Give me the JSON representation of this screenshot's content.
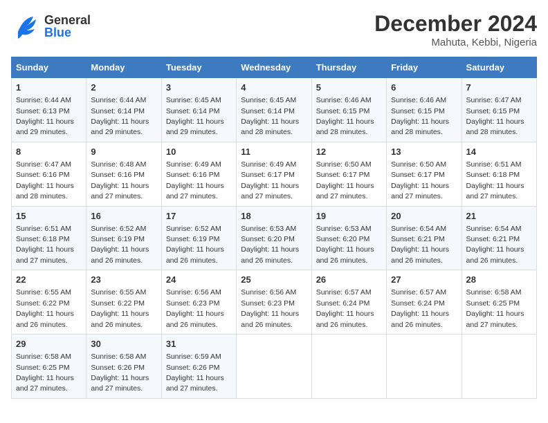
{
  "header": {
    "logo_general": "General",
    "logo_blue": "Blue",
    "month_title": "December 2024",
    "location": "Mahuta, Kebbi, Nigeria"
  },
  "days_of_week": [
    "Sunday",
    "Monday",
    "Tuesday",
    "Wednesday",
    "Thursday",
    "Friday",
    "Saturday"
  ],
  "weeks": [
    [
      {
        "day": "1",
        "sunrise": "Sunrise: 6:44 AM",
        "sunset": "Sunset: 6:13 PM",
        "daylight": "Daylight: 11 hours and 29 minutes."
      },
      {
        "day": "2",
        "sunrise": "Sunrise: 6:44 AM",
        "sunset": "Sunset: 6:14 PM",
        "daylight": "Daylight: 11 hours and 29 minutes."
      },
      {
        "day": "3",
        "sunrise": "Sunrise: 6:45 AM",
        "sunset": "Sunset: 6:14 PM",
        "daylight": "Daylight: 11 hours and 29 minutes."
      },
      {
        "day": "4",
        "sunrise": "Sunrise: 6:45 AM",
        "sunset": "Sunset: 6:14 PM",
        "daylight": "Daylight: 11 hours and 28 minutes."
      },
      {
        "day": "5",
        "sunrise": "Sunrise: 6:46 AM",
        "sunset": "Sunset: 6:15 PM",
        "daylight": "Daylight: 11 hours and 28 minutes."
      },
      {
        "day": "6",
        "sunrise": "Sunrise: 6:46 AM",
        "sunset": "Sunset: 6:15 PM",
        "daylight": "Daylight: 11 hours and 28 minutes."
      },
      {
        "day": "7",
        "sunrise": "Sunrise: 6:47 AM",
        "sunset": "Sunset: 6:15 PM",
        "daylight": "Daylight: 11 hours and 28 minutes."
      }
    ],
    [
      {
        "day": "8",
        "sunrise": "Sunrise: 6:47 AM",
        "sunset": "Sunset: 6:16 PM",
        "daylight": "Daylight: 11 hours and 28 minutes."
      },
      {
        "day": "9",
        "sunrise": "Sunrise: 6:48 AM",
        "sunset": "Sunset: 6:16 PM",
        "daylight": "Daylight: 11 hours and 27 minutes."
      },
      {
        "day": "10",
        "sunrise": "Sunrise: 6:49 AM",
        "sunset": "Sunset: 6:16 PM",
        "daylight": "Daylight: 11 hours and 27 minutes."
      },
      {
        "day": "11",
        "sunrise": "Sunrise: 6:49 AM",
        "sunset": "Sunset: 6:17 PM",
        "daylight": "Daylight: 11 hours and 27 minutes."
      },
      {
        "day": "12",
        "sunrise": "Sunrise: 6:50 AM",
        "sunset": "Sunset: 6:17 PM",
        "daylight": "Daylight: 11 hours and 27 minutes."
      },
      {
        "day": "13",
        "sunrise": "Sunrise: 6:50 AM",
        "sunset": "Sunset: 6:17 PM",
        "daylight": "Daylight: 11 hours and 27 minutes."
      },
      {
        "day": "14",
        "sunrise": "Sunrise: 6:51 AM",
        "sunset": "Sunset: 6:18 PM",
        "daylight": "Daylight: 11 hours and 27 minutes."
      }
    ],
    [
      {
        "day": "15",
        "sunrise": "Sunrise: 6:51 AM",
        "sunset": "Sunset: 6:18 PM",
        "daylight": "Daylight: 11 hours and 27 minutes."
      },
      {
        "day": "16",
        "sunrise": "Sunrise: 6:52 AM",
        "sunset": "Sunset: 6:19 PM",
        "daylight": "Daylight: 11 hours and 26 minutes."
      },
      {
        "day": "17",
        "sunrise": "Sunrise: 6:52 AM",
        "sunset": "Sunset: 6:19 PM",
        "daylight": "Daylight: 11 hours and 26 minutes."
      },
      {
        "day": "18",
        "sunrise": "Sunrise: 6:53 AM",
        "sunset": "Sunset: 6:20 PM",
        "daylight": "Daylight: 11 hours and 26 minutes."
      },
      {
        "day": "19",
        "sunrise": "Sunrise: 6:53 AM",
        "sunset": "Sunset: 6:20 PM",
        "daylight": "Daylight: 11 hours and 26 minutes."
      },
      {
        "day": "20",
        "sunrise": "Sunrise: 6:54 AM",
        "sunset": "Sunset: 6:21 PM",
        "daylight": "Daylight: 11 hours and 26 minutes."
      },
      {
        "day": "21",
        "sunrise": "Sunrise: 6:54 AM",
        "sunset": "Sunset: 6:21 PM",
        "daylight": "Daylight: 11 hours and 26 minutes."
      }
    ],
    [
      {
        "day": "22",
        "sunrise": "Sunrise: 6:55 AM",
        "sunset": "Sunset: 6:22 PM",
        "daylight": "Daylight: 11 hours and 26 minutes."
      },
      {
        "day": "23",
        "sunrise": "Sunrise: 6:55 AM",
        "sunset": "Sunset: 6:22 PM",
        "daylight": "Daylight: 11 hours and 26 minutes."
      },
      {
        "day": "24",
        "sunrise": "Sunrise: 6:56 AM",
        "sunset": "Sunset: 6:23 PM",
        "daylight": "Daylight: 11 hours and 26 minutes."
      },
      {
        "day": "25",
        "sunrise": "Sunrise: 6:56 AM",
        "sunset": "Sunset: 6:23 PM",
        "daylight": "Daylight: 11 hours and 26 minutes."
      },
      {
        "day": "26",
        "sunrise": "Sunrise: 6:57 AM",
        "sunset": "Sunset: 6:24 PM",
        "daylight": "Daylight: 11 hours and 26 minutes."
      },
      {
        "day": "27",
        "sunrise": "Sunrise: 6:57 AM",
        "sunset": "Sunset: 6:24 PM",
        "daylight": "Daylight: 11 hours and 26 minutes."
      },
      {
        "day": "28",
        "sunrise": "Sunrise: 6:58 AM",
        "sunset": "Sunset: 6:25 PM",
        "daylight": "Daylight: 11 hours and 27 minutes."
      }
    ],
    [
      {
        "day": "29",
        "sunrise": "Sunrise: 6:58 AM",
        "sunset": "Sunset: 6:25 PM",
        "daylight": "Daylight: 11 hours and 27 minutes."
      },
      {
        "day": "30",
        "sunrise": "Sunrise: 6:58 AM",
        "sunset": "Sunset: 6:26 PM",
        "daylight": "Daylight: 11 hours and 27 minutes."
      },
      {
        "day": "31",
        "sunrise": "Sunrise: 6:59 AM",
        "sunset": "Sunset: 6:26 PM",
        "daylight": "Daylight: 11 hours and 27 minutes."
      },
      null,
      null,
      null,
      null
    ]
  ]
}
